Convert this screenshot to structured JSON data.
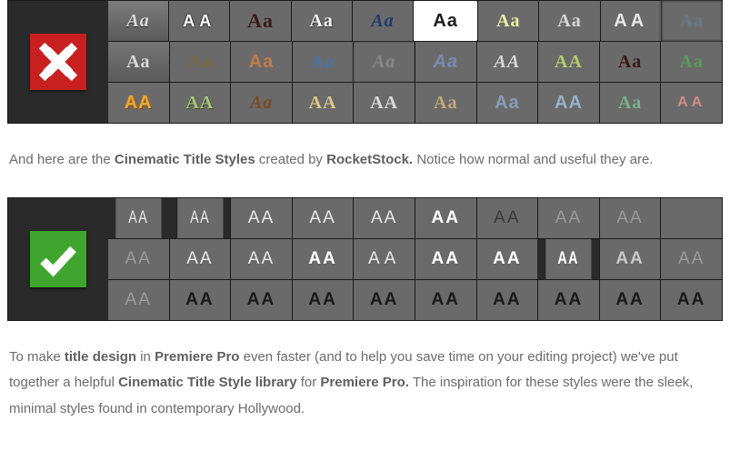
{
  "bad_panel": {
    "icon": "cross-icon",
    "rows": [
      [
        {
          "text": "Aa",
          "cls": "b0"
        },
        {
          "text": "AA",
          "cls": "b1"
        },
        {
          "text": "Aa",
          "cls": "b2"
        },
        {
          "text": "Aa",
          "cls": "b3"
        },
        {
          "text": "Aa",
          "cls": "b4"
        },
        {
          "text": "Aa",
          "cls": "b5"
        },
        {
          "text": "Aa",
          "cls": "b6"
        },
        {
          "text": "Aa",
          "cls": "b7"
        },
        {
          "text": "AA",
          "cls": "b8"
        },
        {
          "text": "Aa",
          "cls": "b9"
        }
      ],
      [
        {
          "text": "Aa",
          "cls": "b10"
        },
        {
          "text": "Aa",
          "cls": "b11"
        },
        {
          "text": "Aa",
          "cls": "b12"
        },
        {
          "text": "Aa",
          "cls": "b13"
        },
        {
          "text": "Aa",
          "cls": "b14"
        },
        {
          "text": "Aa",
          "cls": "b15"
        },
        {
          "text": "AA",
          "cls": "b16"
        },
        {
          "text": "AA",
          "cls": "b17"
        },
        {
          "text": "Aa",
          "cls": "b18"
        },
        {
          "text": "Aa",
          "cls": "b19"
        }
      ],
      [
        {
          "text": "AA",
          "cls": "b20"
        },
        {
          "text": "AA",
          "cls": "b21"
        },
        {
          "text": "Aa",
          "cls": "b22"
        },
        {
          "text": "AA",
          "cls": "b23"
        },
        {
          "text": "AA",
          "cls": "b24"
        },
        {
          "text": "Aa",
          "cls": "b25"
        },
        {
          "text": "Aa",
          "cls": "b26"
        },
        {
          "text": "AA",
          "cls": "b27"
        },
        {
          "text": "Aa",
          "cls": "b28"
        },
        {
          "text": "AA",
          "cls": "b29"
        }
      ]
    ]
  },
  "good_panel": {
    "icon": "check-icon",
    "rows": [
      [
        {
          "text": "AA",
          "cls": "g gw gcond"
        },
        {
          "text": "AA",
          "cls": "g gw gcond gthin"
        },
        {
          "text": "AA",
          "cls": "g gw gthin"
        },
        {
          "text": "AA",
          "cls": "g gw"
        },
        {
          "text": "AA",
          "cls": "g gw gthin"
        },
        {
          "text": "AA",
          "cls": "g gwb"
        },
        {
          "text": "AA",
          "cls": "g gd"
        },
        {
          "text": "AA",
          "cls": "g gm gthin"
        },
        {
          "text": "AA",
          "cls": "g gm gthin"
        },
        {
          "text": "",
          "cls": "gempty"
        }
      ],
      [
        {
          "text": "AA",
          "cls": "g gm gthin"
        },
        {
          "text": "AA",
          "cls": "g gw gthin"
        },
        {
          "text": "AA",
          "cls": "g gw gthin"
        },
        {
          "text": "AA",
          "cls": "g gwb"
        },
        {
          "text": "AA",
          "cls": "g gw gwide"
        },
        {
          "text": "AA",
          "cls": "g gwb"
        },
        {
          "text": "AA",
          "cls": "g gwb"
        },
        {
          "text": "AA",
          "cls": "g gwb gcond"
        },
        {
          "text": "AA",
          "cls": "g gmb"
        },
        {
          "text": "AA",
          "cls": "g gm"
        }
      ],
      [
        {
          "text": "AA",
          "cls": "g gm"
        },
        {
          "text": "AA",
          "cls": "g gdb"
        },
        {
          "text": "AA",
          "cls": "g gdb"
        },
        {
          "text": "AA",
          "cls": "g gdb"
        },
        {
          "text": "AA",
          "cls": "g gdb"
        },
        {
          "text": "AA",
          "cls": "g gdb"
        },
        {
          "text": "AA",
          "cls": "g gdb"
        },
        {
          "text": "AA",
          "cls": "g gdb"
        },
        {
          "text": "AA",
          "cls": "g gdb"
        },
        {
          "text": "AA",
          "cls": "g gdb"
        }
      ]
    ]
  },
  "para1": {
    "t1": "And here are the ",
    "b1": "Cinematic Title Styles",
    "t2": " created by ",
    "b2": "RocketStock.",
    "t3": " Notice how normal and useful they are."
  },
  "para2": {
    "t1": "To make ",
    "b1": "title design",
    "t2": " in ",
    "b2": "Premiere Pro",
    "t3": " even faster (and to help you save time on your editing project) we've put together a helpful ",
    "b3": "Cinematic Title Style library",
    "t4": " for ",
    "b4": "Premiere Pro.",
    "t5": " The inspiration for these styles were the sleek, minimal styles found in contemporary Hollywood."
  }
}
